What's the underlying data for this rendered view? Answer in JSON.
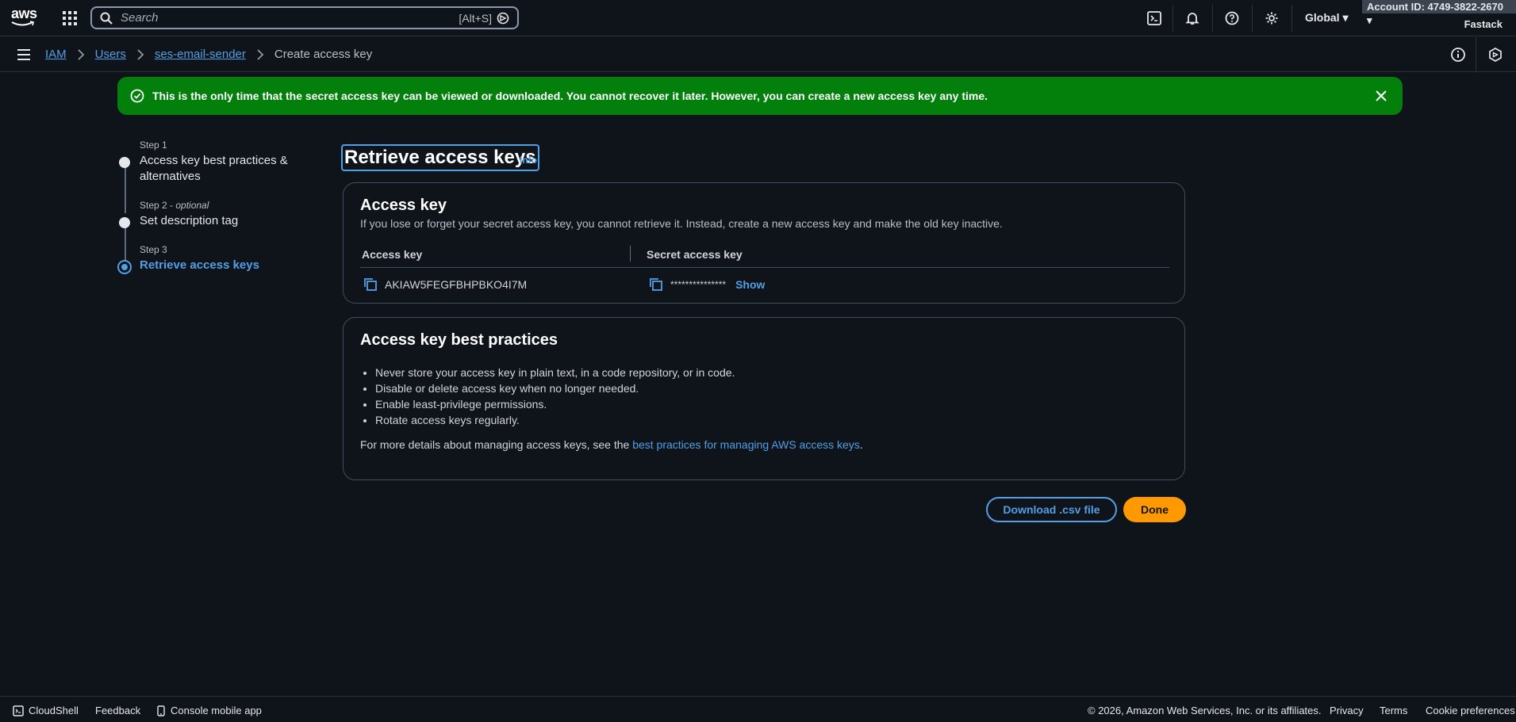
{
  "topnav": {
    "logo_text": "aws",
    "search_placeholder": "Search",
    "search_shortcut": "[Alt+S]",
    "region": "Global ▾",
    "account": "Account ID: 4749-3822-2670 ▾",
    "user": "Fastack"
  },
  "breadcrumbs": {
    "items": [
      "IAM",
      "Users",
      "ses-email-sender"
    ],
    "current": "Create access key"
  },
  "flash": {
    "message": "This is the only time that the secret access key can be viewed or downloaded. You cannot recover it later. However, you can create a new access key any time."
  },
  "steps": [
    {
      "label": "Step 1",
      "optional": "",
      "title": "Access key best practices & alternatives"
    },
    {
      "label": "Step 2 - ",
      "optional": "optional",
      "title": "Set description tag"
    },
    {
      "label": "Step 3",
      "optional": "",
      "title": "Retrieve access keys"
    }
  ],
  "page": {
    "title": "Retrieve access keys",
    "info": "Info"
  },
  "access_key_card": {
    "heading": "Access key",
    "description": "If you lose or forget your secret access key, you cannot retrieve it. Instead, create a new access key and make the old key inactive.",
    "col_access_key": "Access key",
    "col_secret": "Secret access key",
    "access_key_value": "AKIAW5FEGFBHPBKO4I7M",
    "secret_masked": "***************",
    "show_label": "Show"
  },
  "best_practices_card": {
    "heading": "Access key best practices",
    "items": [
      "Never store your access key in plain text, in a code repository, or in code.",
      "Disable or delete access key when no longer needed.",
      "Enable least-privilege permissions.",
      "Rotate access keys regularly."
    ],
    "more_prefix": "For more details about managing access keys, see the ",
    "more_link": "best practices for managing AWS access keys",
    "more_suffix": "."
  },
  "actions": {
    "download": "Download .csv file",
    "done": "Done"
  },
  "footer": {
    "cloudshell": "CloudShell",
    "feedback": "Feedback",
    "mobile": "Console mobile app",
    "copyright": "© 2026, Amazon Web Services, Inc. or its affiliates.",
    "privacy": "Privacy",
    "terms": "Terms",
    "cookies": "Cookie preferences"
  },
  "colors": {
    "accent": "#539fe5",
    "success": "#037f0c",
    "primary_button": "#ff9900",
    "background": "#0f141a"
  }
}
